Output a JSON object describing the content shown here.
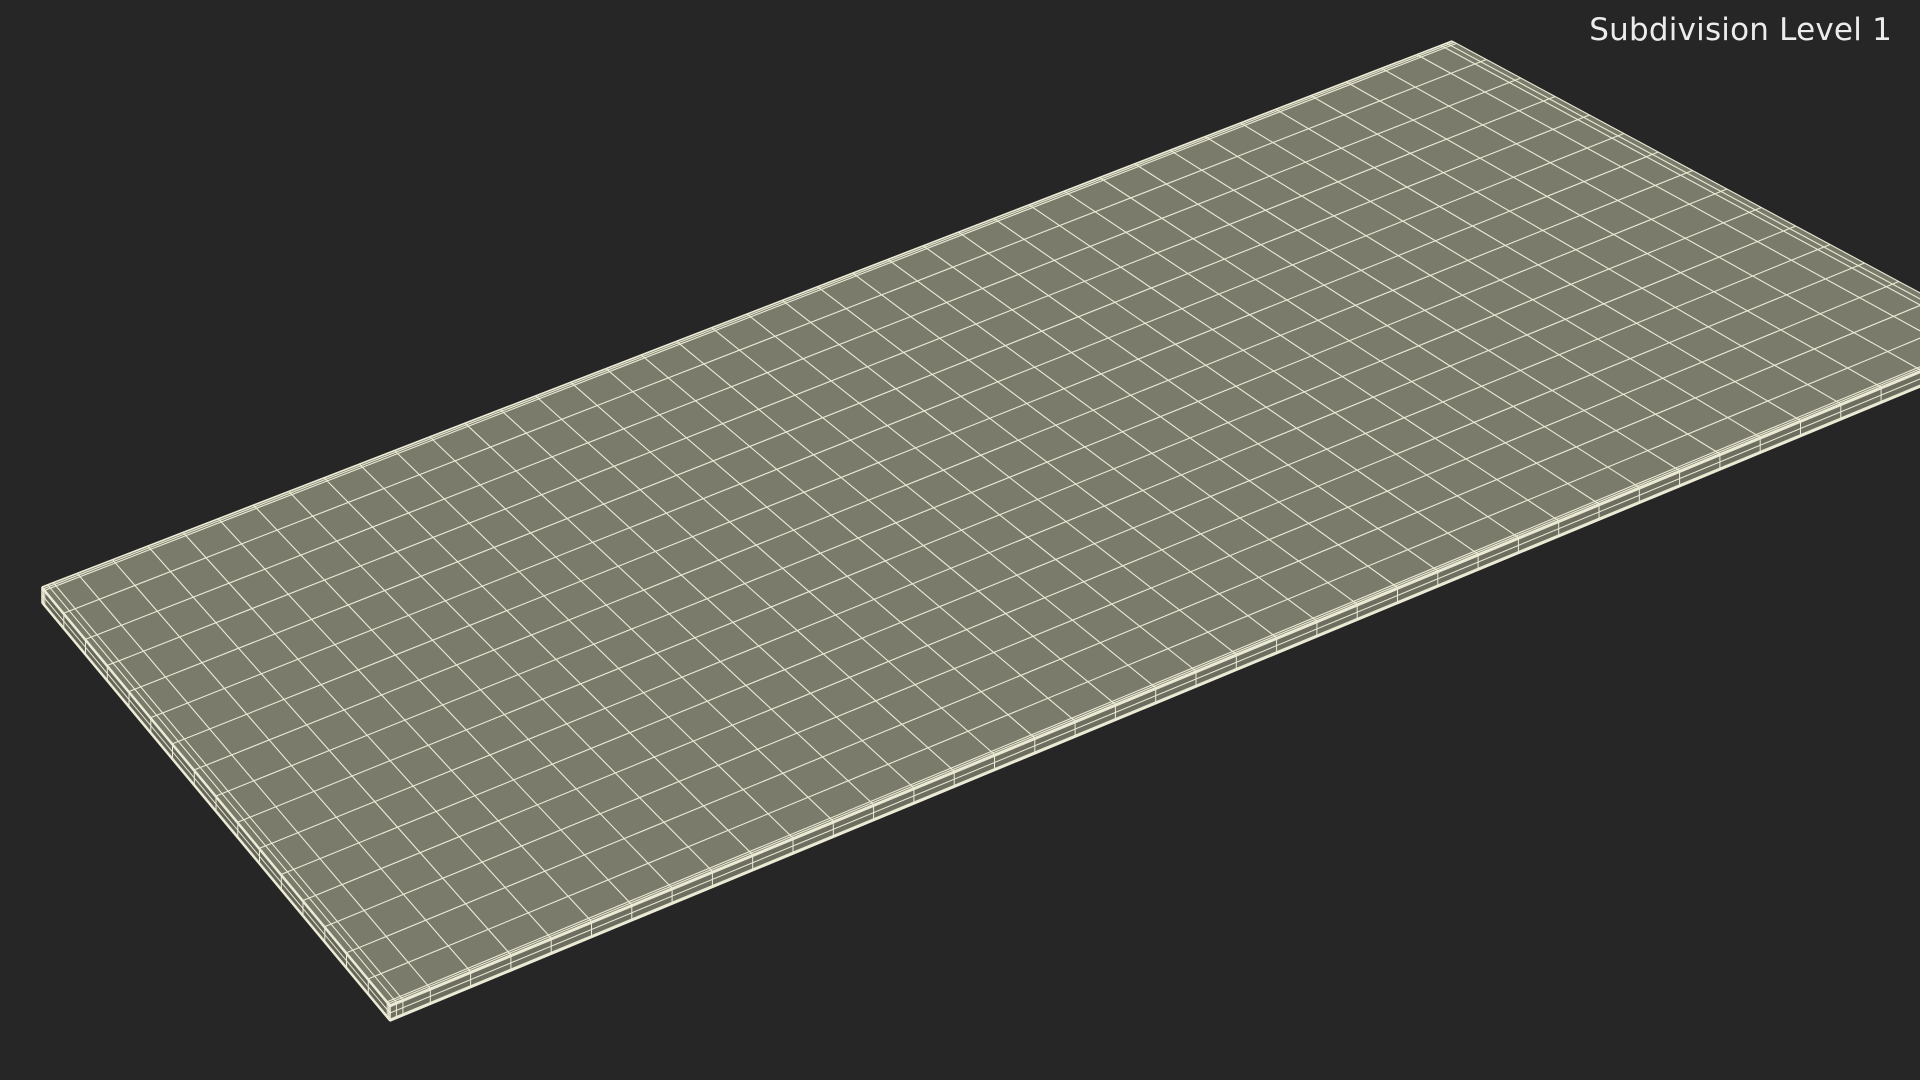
{
  "caption": "Subdivision Level 1",
  "colors": {
    "background": "#262626",
    "top_face": "#7b7b6c",
    "front_face": "#6e6e60",
    "side_face": "#66665a",
    "wire": "#ecebd6"
  }
}
